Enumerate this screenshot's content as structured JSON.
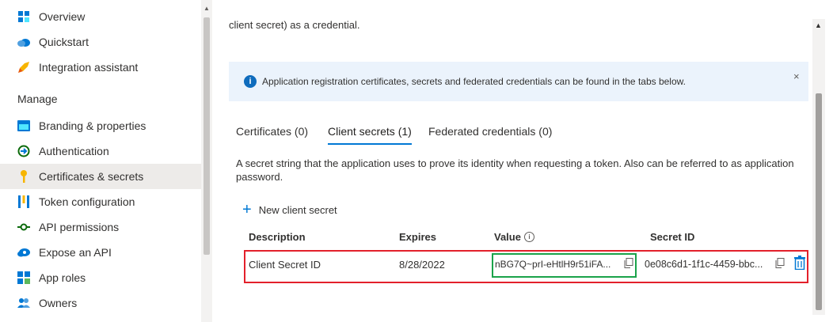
{
  "sidebar": {
    "items": [
      {
        "label": "Overview",
        "icon": "overview-grid-icon"
      },
      {
        "label": "Quickstart",
        "icon": "quickstart-cloud-icon"
      },
      {
        "label": "Integration assistant",
        "icon": "rocket-icon"
      },
      {
        "label": "Branding & properties",
        "icon": "branding-icon"
      },
      {
        "label": "Authentication",
        "icon": "authentication-icon"
      },
      {
        "label": "Certificates & secrets",
        "icon": "key-icon"
      },
      {
        "label": "Token configuration",
        "icon": "token-bars-icon"
      },
      {
        "label": "API permissions",
        "icon": "api-permissions-icon"
      },
      {
        "label": "Expose an API",
        "icon": "cloud-icon"
      },
      {
        "label": "App roles",
        "icon": "app-roles-icon"
      },
      {
        "label": "Owners",
        "icon": "owners-icon"
      }
    ],
    "manage_heading": "Manage",
    "selected": "Certificates & secrets"
  },
  "main": {
    "intro_text": "client secret) as a credential.",
    "info_bar": {
      "text": "Application registration certificates, secrets and federated credentials can be found in the tabs below.",
      "close": "×"
    },
    "tabs": [
      {
        "label": "Certificates (0)"
      },
      {
        "label": "Client secrets (1)"
      },
      {
        "label": "Federated credentials (0)"
      }
    ],
    "active_tab": "Client secrets (1)",
    "description": "A secret string that the application uses to prove its identity when requesting a token. Also can be referred to as application password.",
    "new_secret_label": "New client secret",
    "table": {
      "headers": [
        "Description",
        "Expires",
        "Value",
        "Secret ID"
      ],
      "rows": [
        {
          "description": "Client Secret ID",
          "expires": "8/28/2022",
          "value": "nBG7Q~prI-eHtlH9r51iFA...",
          "secret_id": "0e08c6d1-1f1c-4459-bbc..."
        }
      ]
    }
  },
  "colors": {
    "accent": "#0078d4",
    "highlight_row": "#e3202b",
    "highlight_value": "#1aa34a",
    "info_bar_bg": "#ebf3fc"
  }
}
